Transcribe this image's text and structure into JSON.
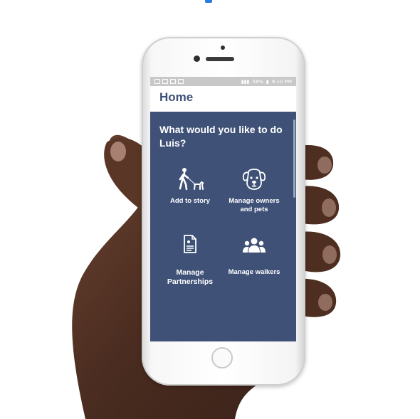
{
  "screen": {
    "status_bar": {
      "battery": "58%",
      "time": "9:10 PM"
    },
    "page_title": "Home",
    "question": "What would you like to do Luis?",
    "tiles": [
      {
        "label": "Add to story",
        "icon": "dog-walker-icon"
      },
      {
        "label": "Manage owners and pets",
        "icon": "dog-face-icon"
      },
      {
        "label": "Manage Partnerships",
        "icon": "document-icon"
      },
      {
        "label": "Manage walkers",
        "icon": "group-icon"
      }
    ]
  },
  "colors": {
    "panel": "#3f5177",
    "title": "#3f5177",
    "status_bar": "#c8c8c8",
    "top_mark": "#2a7de1"
  }
}
